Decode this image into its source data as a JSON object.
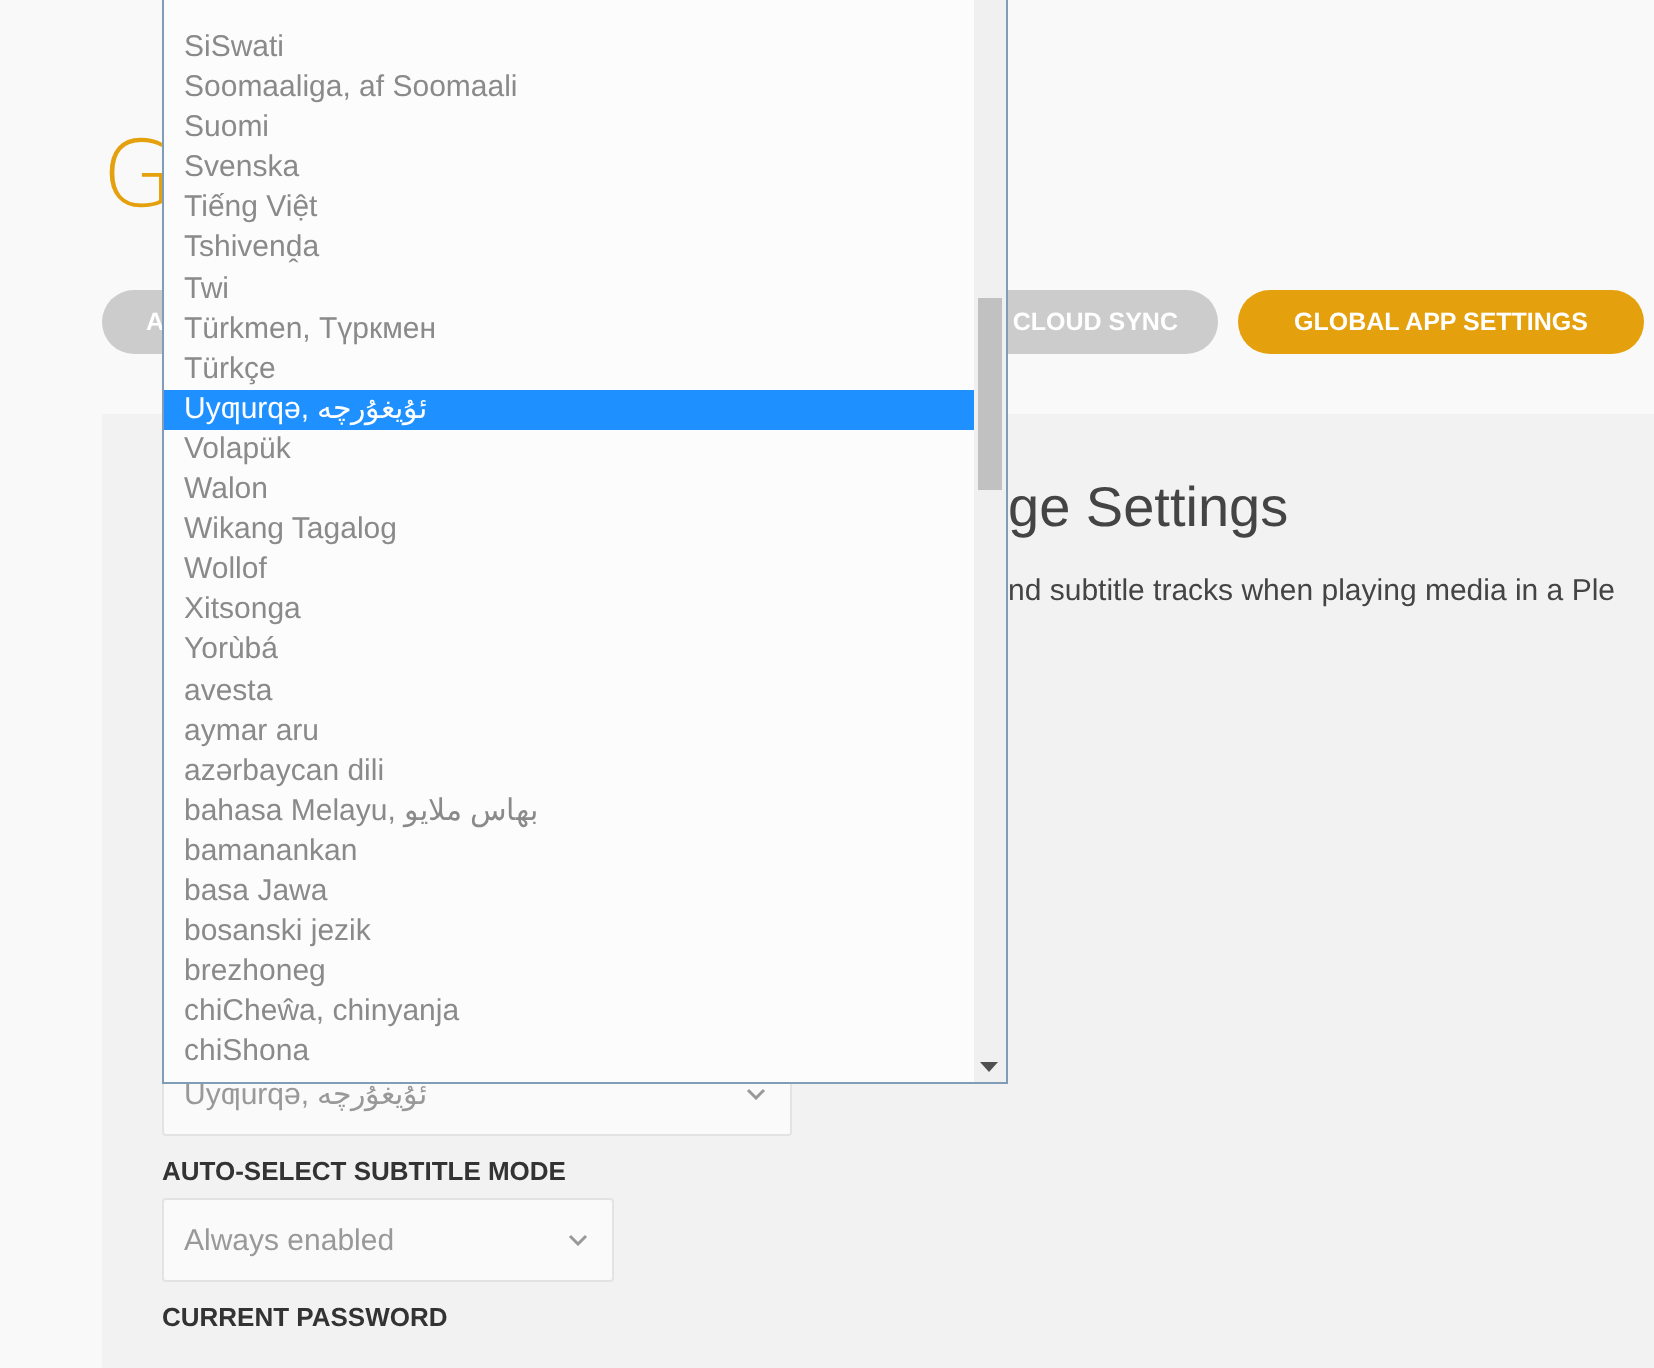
{
  "heading": {
    "text": "G"
  },
  "tabs": [
    {
      "label": "A",
      "selected": false
    },
    {
      "label": "CLOUD SYNC",
      "selected": false
    },
    {
      "label": "GLOBAL APP SETTINGS",
      "selected": true
    }
  ],
  "panel": {
    "title": "ge Settings",
    "description": "nd subtitle tracks when playing media in a Ple"
  },
  "language_select": {
    "value": "Uyƣurqə, ئۇيغۇرچە",
    "expanded": true,
    "options": [
      {
        "label": "SiSwati",
        "selected": false
      },
      {
        "label": "Soomaaliga, af Soomaali",
        "selected": false
      },
      {
        "label": "Suomi",
        "selected": false
      },
      {
        "label": "Svenska",
        "selected": false
      },
      {
        "label": "Tiếng Việt",
        "selected": false
      },
      {
        "label": "Tshivenḓa",
        "selected": false
      },
      {
        "label": "Twi",
        "selected": false
      },
      {
        "label": "Türkmen, Түркмен",
        "selected": false
      },
      {
        "label": "Türkçe",
        "selected": false
      },
      {
        "label": "Uyƣurqə, ئۇيغۇرچە",
        "selected": true
      },
      {
        "label": "Volapük",
        "selected": false
      },
      {
        "label": "Walon",
        "selected": false
      },
      {
        "label": "Wikang Tagalog",
        "selected": false
      },
      {
        "label": "Wollof",
        "selected": false
      },
      {
        "label": "Xitsonga",
        "selected": false
      },
      {
        "label": "Yorùbá",
        "selected": false
      },
      {
        "label": "avesta",
        "selected": false
      },
      {
        "label": "aymar aru",
        "selected": false
      },
      {
        "label": "azərbaycan dili",
        "selected": false
      },
      {
        "label": "bahasa Melayu, بهاس ملايو",
        "selected": false
      },
      {
        "label": "bamanankan",
        "selected": false
      },
      {
        "label": "basa Jawa",
        "selected": false
      },
      {
        "label": "bosanski jezik",
        "selected": false
      },
      {
        "label": "brezhoneg",
        "selected": false
      },
      {
        "label": "chiCheŵa, chinyanja",
        "selected": false
      },
      {
        "label": "chiShona",
        "selected": false
      }
    ]
  },
  "subtitle_mode": {
    "label": "AUTO-SELECT SUBTITLE MODE",
    "value": "Always enabled"
  },
  "password": {
    "label": "CURRENT PASSWORD"
  }
}
